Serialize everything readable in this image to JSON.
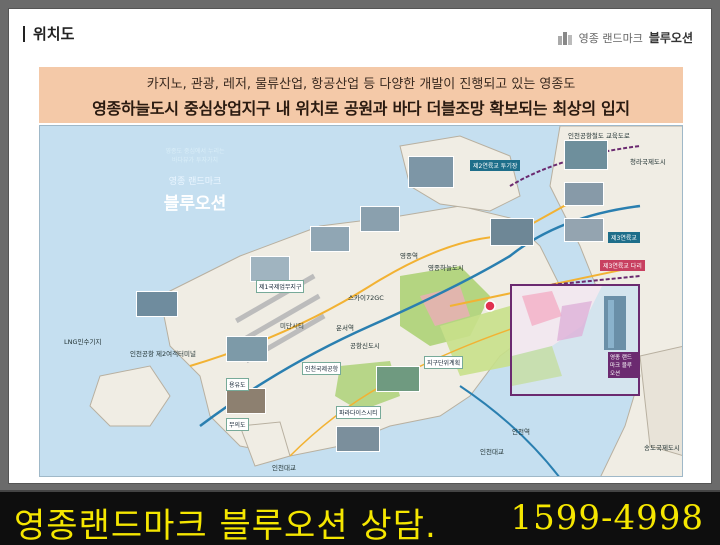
{
  "section": {
    "title": "위치도"
  },
  "brand": {
    "prefix": "영종 랜드마크",
    "name": "블루오션",
    "logo_icon": "building-logo-icon"
  },
  "banner": {
    "line1": "카지노, 관광, 레저, 물류산업, 항공산업 등 다양한 개발이 진행되고 있는 영종도",
    "line2": "영종하늘도시 중심상업지구 내 위치로 공원과 바다 더블조망 확보되는 최상의 입지"
  },
  "map": {
    "brand_box": {
      "sub1": "영종도 중심에서 누리는",
      "sub2": "바다뷰가 투자가치",
      "title_small": "영종 랜드마크",
      "title_big": "블루오션"
    },
    "labels": [
      "인천공항철도 교육도로",
      "제2연륙교 투기장",
      "청라국제도시",
      "영종하늘도시",
      "제3연륙교",
      "송도국제도시",
      "인천국제공항",
      "인천대교",
      "스카이72GC",
      "영종역",
      "운서역",
      "공항신도시",
      "파라다이스시티",
      "지구단위계획",
      "제1국제업무지구",
      "LNG인수기지",
      "용유도",
      "무의도",
      "인천공항 제2여객터미널",
      "미단시티",
      "인천대교",
      "인천역"
    ],
    "inset_tag": "영종 랜드마크 블루오션",
    "highlight_label": "제3연륙교 다리"
  },
  "footer": {
    "text": "영종랜드마크 블루오션 상담.",
    "phone": "1599-4998"
  },
  "colors": {
    "sea": "#c5dff0",
    "land": "#f0ede4",
    "green": "#a9d070",
    "purple": "#6b2a70",
    "banner": "#f4c9a8",
    "footer_text": "#f5e600"
  }
}
